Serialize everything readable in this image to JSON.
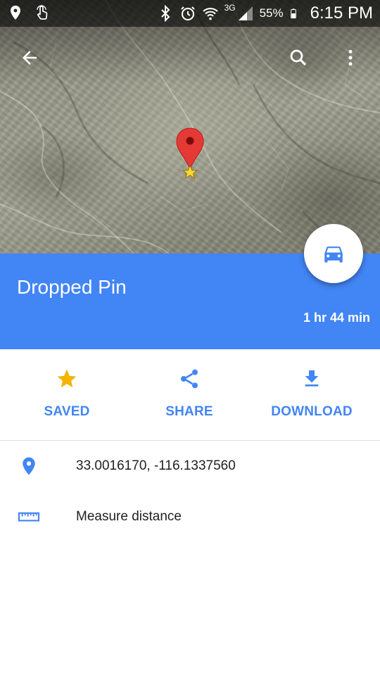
{
  "status_bar": {
    "network_label": "3G",
    "battery_percent": "55%",
    "time": "6:15 PM",
    "icons": [
      "location-icon",
      "touch-icon",
      "bluetooth-icon",
      "alarm-icon",
      "wifi-icon",
      "signal-icon",
      "battery-icon"
    ]
  },
  "toolbar": {
    "icons": [
      "back-arrow-icon",
      "search-icon",
      "more-vert-icon"
    ]
  },
  "map": {
    "view": "satellite",
    "marker_icon": "red-pin-with-star-icon"
  },
  "place": {
    "title": "Dropped Pin",
    "travel_time": "1 hr 44 min",
    "directions_icon": "car-icon",
    "header_color": "#4285f4"
  },
  "actions": [
    {
      "label": "SAVED",
      "icon": "star-icon",
      "icon_color": "#f4b400"
    },
    {
      "label": "SHARE",
      "icon": "share-icon",
      "icon_color": "#4285f4"
    },
    {
      "label": "DOWNLOAD",
      "icon": "download-icon",
      "icon_color": "#4285f4"
    }
  ],
  "details": {
    "coordinates": "33.0016170, -116.1337560",
    "measure_label": "Measure distance"
  },
  "colors": {
    "accent": "#4285f4",
    "star": "#f4b400",
    "marker": "#e53935"
  }
}
